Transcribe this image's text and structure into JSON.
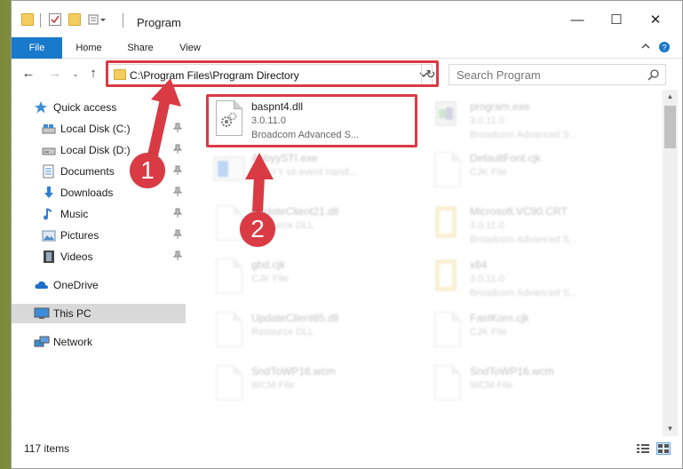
{
  "window": {
    "title": "Program",
    "controls": {
      "minimize": "—",
      "maximize": "☐",
      "close": "✕"
    }
  },
  "ribbon": {
    "tabs": [
      {
        "label": "File"
      },
      {
        "label": "Home"
      },
      {
        "label": "Share"
      },
      {
        "label": "View"
      }
    ]
  },
  "address_bar": {
    "path": "C:\\Program Files\\Program Directory"
  },
  "search": {
    "placeholder": "Search Program"
  },
  "sidebar": {
    "items": [
      {
        "label": "Quick access"
      },
      {
        "label": "Local Disk (C:)"
      },
      {
        "label": "Local Disk (D:)"
      },
      {
        "label": "Documents"
      },
      {
        "label": "Downloads"
      },
      {
        "label": "Music"
      },
      {
        "label": "Pictures"
      },
      {
        "label": "Videos"
      },
      {
        "label": "OneDrive"
      },
      {
        "label": "This PC"
      },
      {
        "label": "Network"
      }
    ]
  },
  "files": [
    {
      "name": "baspnt4.dll",
      "line2": "3.0.11.0",
      "line3": "Broadcom Advanced S..."
    },
    {
      "name": "program.exe",
      "line2": "3.0.11.0",
      "line3": "Broadcom Advanced S..."
    },
    {
      "name": "AbbyySTI.exe",
      "line2": "ABBYY sti event handl...",
      "line3": ""
    },
    {
      "name": "DefaultFont.cjk",
      "line2": "CJK File",
      "line3": ""
    },
    {
      "name": "UpdateClient21.dll",
      "line2": "Resource DLL",
      "line3": ""
    },
    {
      "name": "Microsoft.VC90.CRT",
      "line2": "3.0.11.0",
      "line3": "Broadcom Advanced S..."
    },
    {
      "name": "gbd.cjk",
      "line2": "CJK File",
      "line3": ""
    },
    {
      "name": "x64",
      "line2": "3.0.11.0",
      "line3": "Broadcom Advanced S..."
    },
    {
      "name": "UpdateClient65.dll",
      "line2": "Resource DLL",
      "line3": ""
    },
    {
      "name": "FastKorn.cjk",
      "line2": "CJK File",
      "line3": ""
    },
    {
      "name": "SndToWP16.wcm",
      "line2": "WCM File",
      "line3": ""
    },
    {
      "name": "SndToWP16.wcm",
      "line2": "WCM File",
      "line3": ""
    }
  ],
  "status": {
    "item_count": "117 items"
  },
  "callouts": {
    "one": "1",
    "two": "2"
  },
  "colors": {
    "accent": "#1979ca",
    "highlight_red": "#d93a44",
    "folder_yellow": "#f3cd5f",
    "selected_nav": "#d9d9d9"
  }
}
